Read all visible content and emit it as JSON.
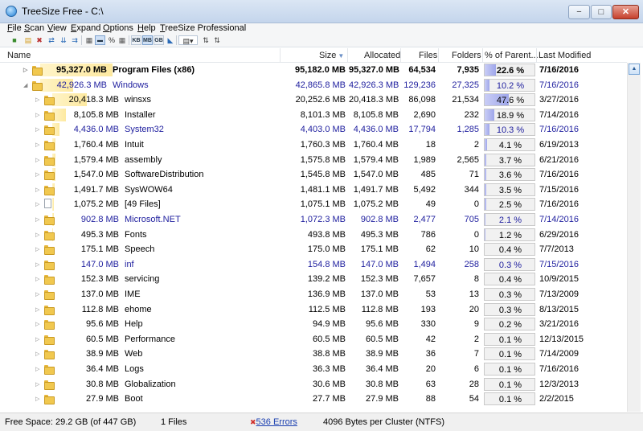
{
  "window": {
    "title": "TreeSize Free - C:\\"
  },
  "menu": [
    "File",
    "Scan",
    "View",
    "Expand",
    "Options",
    "Help",
    "TreeSize Professional"
  ],
  "toolbar": {
    "unit_buttons": [
      "KB",
      "MB",
      "GB"
    ],
    "percent_glyph": "%"
  },
  "columns": {
    "name": "Name",
    "size": "Size",
    "allocated": "Allocated",
    "files": "Files",
    "folders": "Folders",
    "percent": "% of Parent...",
    "modified": "Last Modified"
  },
  "rows": [
    {
      "size_label": "95,327.0 MB",
      "name": "Program Files (x86)",
      "size": "95,182.0 MB",
      "allocated": "95,327.0 MB",
      "files": "64,534",
      "folders": "7,935",
      "percent_text": "22.6 %",
      "percent": 0.226,
      "modified": "7/16/2016",
      "depth": 0,
      "expanded": false,
      "bold": true,
      "blue": false,
      "icon": "folder-icon",
      "barfrac": 1.0
    },
    {
      "size_label": "42,926.3 MB",
      "name": "Windows",
      "size": "42,865.8 MB",
      "allocated": "42,926.3 MB",
      "files": "129,236",
      "folders": "27,325",
      "percent_text": "10.2 %",
      "percent": 0.102,
      "modified": "7/16/2016",
      "depth": 0,
      "expanded": true,
      "bold": false,
      "blue": true,
      "icon": "folder-icon",
      "barfrac": 0.45
    },
    {
      "size_label": "20,418.3 MB",
      "name": "winsxs",
      "size": "20,252.6 MB",
      "allocated": "20,418.3 MB",
      "files": "86,098",
      "folders": "21,534",
      "percent_text": "47.6 %",
      "percent": 0.476,
      "modified": "3/27/2016",
      "depth": 1,
      "expanded": false,
      "bold": false,
      "blue": false,
      "icon": "folder-icon",
      "barfrac": 0.48
    },
    {
      "size_label": "8,105.8 MB",
      "name": "Installer",
      "size": "8,101.3 MB",
      "allocated": "8,105.8 MB",
      "files": "2,690",
      "folders": "232",
      "percent_text": "18.9 %",
      "percent": 0.189,
      "modified": "7/14/2016",
      "depth": 1,
      "expanded": false,
      "bold": false,
      "blue": false,
      "icon": "folder-icon",
      "barfrac": 0.19
    },
    {
      "size_label": "4,436.0 MB",
      "name": "System32",
      "size": "4,403.0 MB",
      "allocated": "4,436.0 MB",
      "files": "17,794",
      "folders": "1,285",
      "percent_text": "10.3 %",
      "percent": 0.103,
      "modified": "7/16/2016",
      "depth": 1,
      "expanded": false,
      "bold": false,
      "blue": true,
      "icon": "folder-icon",
      "barfrac": 0.1
    },
    {
      "size_label": "1,760.4 MB",
      "name": "Intuit",
      "size": "1,760.3 MB",
      "allocated": "1,760.4 MB",
      "files": "18",
      "folders": "2",
      "percent_text": "4.1 %",
      "percent": 0.041,
      "modified": "6/19/2013",
      "depth": 1,
      "expanded": false,
      "bold": false,
      "blue": false,
      "icon": "folder-icon",
      "barfrac": 0.04
    },
    {
      "size_label": "1,579.4 MB",
      "name": "assembly",
      "size": "1,575.8 MB",
      "allocated": "1,579.4 MB",
      "files": "1,989",
      "folders": "2,565",
      "percent_text": "3.7 %",
      "percent": 0.037,
      "modified": "6/21/2016",
      "depth": 1,
      "expanded": false,
      "bold": false,
      "blue": false,
      "icon": "folder-icon",
      "barfrac": 0.04
    },
    {
      "size_label": "1,547.0 MB",
      "name": "SoftwareDistribution",
      "size": "1,545.8 MB",
      "allocated": "1,547.0 MB",
      "files": "485",
      "folders": "71",
      "percent_text": "3.6 %",
      "percent": 0.036,
      "modified": "7/16/2016",
      "depth": 1,
      "expanded": false,
      "bold": false,
      "blue": false,
      "icon": "folder-icon",
      "barfrac": 0.04
    },
    {
      "size_label": "1,491.7 MB",
      "name": "SysWOW64",
      "size": "1,481.1 MB",
      "allocated": "1,491.7 MB",
      "files": "5,492",
      "folders": "344",
      "percent_text": "3.5 %",
      "percent": 0.035,
      "modified": "7/15/2016",
      "depth": 1,
      "expanded": false,
      "bold": false,
      "blue": false,
      "icon": "folder-icon",
      "barfrac": 0.03
    },
    {
      "size_label": "1,075.2 MB",
      "name": "[49 Files]",
      "size": "1,075.1 MB",
      "allocated": "1,075.2 MB",
      "files": "49",
      "folders": "0",
      "percent_text": "2.5 %",
      "percent": 0.025,
      "modified": "7/16/2016",
      "depth": 1,
      "expanded": false,
      "bold": false,
      "blue": false,
      "icon": "file-icon",
      "barfrac": 0.02
    },
    {
      "size_label": "902.8 MB",
      "name": "Microsoft.NET",
      "size": "1,072.3 MB",
      "allocated": "902.8 MB",
      "files": "2,477",
      "folders": "705",
      "percent_text": "2.1 %",
      "percent": 0.021,
      "modified": "7/14/2016",
      "depth": 1,
      "expanded": false,
      "bold": false,
      "blue": true,
      "icon": "folder-icon",
      "barfrac": 0.02
    },
    {
      "size_label": "495.3 MB",
      "name": "Fonts",
      "size": "493.8 MB",
      "allocated": "495.3 MB",
      "files": "786",
      "folders": "0",
      "percent_text": "1.2 %",
      "percent": 0.012,
      "modified": "6/29/2016",
      "depth": 1,
      "expanded": false,
      "bold": false,
      "blue": false,
      "icon": "folder-icon",
      "barfrac": 0.01
    },
    {
      "size_label": "175.1 MB",
      "name": "Speech",
      "size": "175.0 MB",
      "allocated": "175.1 MB",
      "files": "62",
      "folders": "10",
      "percent_text": "0.4 %",
      "percent": 0.004,
      "modified": "7/7/2013",
      "depth": 1,
      "expanded": false,
      "bold": false,
      "blue": false,
      "icon": "folder-icon",
      "barfrac": 0.0
    },
    {
      "size_label": "147.0 MB",
      "name": "inf",
      "size": "154.8 MB",
      "allocated": "147.0 MB",
      "files": "1,494",
      "folders": "258",
      "percent_text": "0.3 %",
      "percent": 0.003,
      "modified": "7/15/2016",
      "depth": 1,
      "expanded": false,
      "bold": false,
      "blue": true,
      "icon": "folder-icon",
      "barfrac": 0.0
    },
    {
      "size_label": "152.3 MB",
      "name": "servicing",
      "size": "139.2 MB",
      "allocated": "152.3 MB",
      "files": "7,657",
      "folders": "8",
      "percent_text": "0.4 %",
      "percent": 0.004,
      "modified": "10/9/2015",
      "depth": 1,
      "expanded": false,
      "bold": false,
      "blue": false,
      "icon": "folder-icon",
      "barfrac": 0.0
    },
    {
      "size_label": "137.0 MB",
      "name": "IME",
      "size": "136.9 MB",
      "allocated": "137.0 MB",
      "files": "53",
      "folders": "13",
      "percent_text": "0.3 %",
      "percent": 0.003,
      "modified": "7/13/2009",
      "depth": 1,
      "expanded": false,
      "bold": false,
      "blue": false,
      "icon": "folder-icon",
      "barfrac": 0.0
    },
    {
      "size_label": "112.8 MB",
      "name": "ehome",
      "size": "112.5 MB",
      "allocated": "112.8 MB",
      "files": "193",
      "folders": "20",
      "percent_text": "0.3 %",
      "percent": 0.003,
      "modified": "8/13/2015",
      "depth": 1,
      "expanded": false,
      "bold": false,
      "blue": false,
      "icon": "folder-icon",
      "barfrac": 0.0
    },
    {
      "size_label": "95.6 MB",
      "name": "Help",
      "size": "94.9 MB",
      "allocated": "95.6 MB",
      "files": "330",
      "folders": "9",
      "percent_text": "0.2 %",
      "percent": 0.002,
      "modified": "3/21/2016",
      "depth": 1,
      "expanded": false,
      "bold": false,
      "blue": false,
      "icon": "folder-icon",
      "barfrac": 0.0
    },
    {
      "size_label": "60.5 MB",
      "name": "Performance",
      "size": "60.5 MB",
      "allocated": "60.5 MB",
      "files": "42",
      "folders": "2",
      "percent_text": "0.1 %",
      "percent": 0.001,
      "modified": "12/13/2015",
      "depth": 1,
      "expanded": false,
      "bold": false,
      "blue": false,
      "icon": "folder-icon",
      "barfrac": 0.0
    },
    {
      "size_label": "38.9 MB",
      "name": "Web",
      "size": "38.8 MB",
      "allocated": "38.9 MB",
      "files": "36",
      "folders": "7",
      "percent_text": "0.1 %",
      "percent": 0.001,
      "modified": "7/14/2009",
      "depth": 1,
      "expanded": false,
      "bold": false,
      "blue": false,
      "icon": "folder-icon",
      "barfrac": 0.0
    },
    {
      "size_label": "36.4 MB",
      "name": "Logs",
      "size": "36.3 MB",
      "allocated": "36.4 MB",
      "files": "20",
      "folders": "6",
      "percent_text": "0.1 %",
      "percent": 0.001,
      "modified": "7/16/2016",
      "depth": 1,
      "expanded": false,
      "bold": false,
      "blue": false,
      "icon": "folder-icon",
      "barfrac": 0.0
    },
    {
      "size_label": "30.8 MB",
      "name": "Globalization",
      "size": "30.6 MB",
      "allocated": "30.8 MB",
      "files": "63",
      "folders": "28",
      "percent_text": "0.1 %",
      "percent": 0.001,
      "modified": "12/3/2013",
      "depth": 1,
      "expanded": false,
      "bold": false,
      "blue": false,
      "icon": "folder-icon",
      "barfrac": 0.0
    },
    {
      "size_label": "27.9 MB",
      "name": "Boot",
      "size": "27.7 MB",
      "allocated": "27.9 MB",
      "files": "88",
      "folders": "54",
      "percent_text": "0.1 %",
      "percent": 0.001,
      "modified": "2/2/2015",
      "depth": 1,
      "expanded": false,
      "bold": false,
      "blue": false,
      "icon": "folder-icon",
      "barfrac": 0.0
    }
  ],
  "status": {
    "free_space": "Free Space: 29.2 GB  (of 447 GB)",
    "files": "1  Files",
    "errors": "536 Errors",
    "cluster": "4096  Bytes per Cluster (NTFS)"
  },
  "colors": {
    "blue_row": "#1e1e9e",
    "size_bar": "#fde9a0",
    "percent_fill": "#9ea6ea"
  }
}
